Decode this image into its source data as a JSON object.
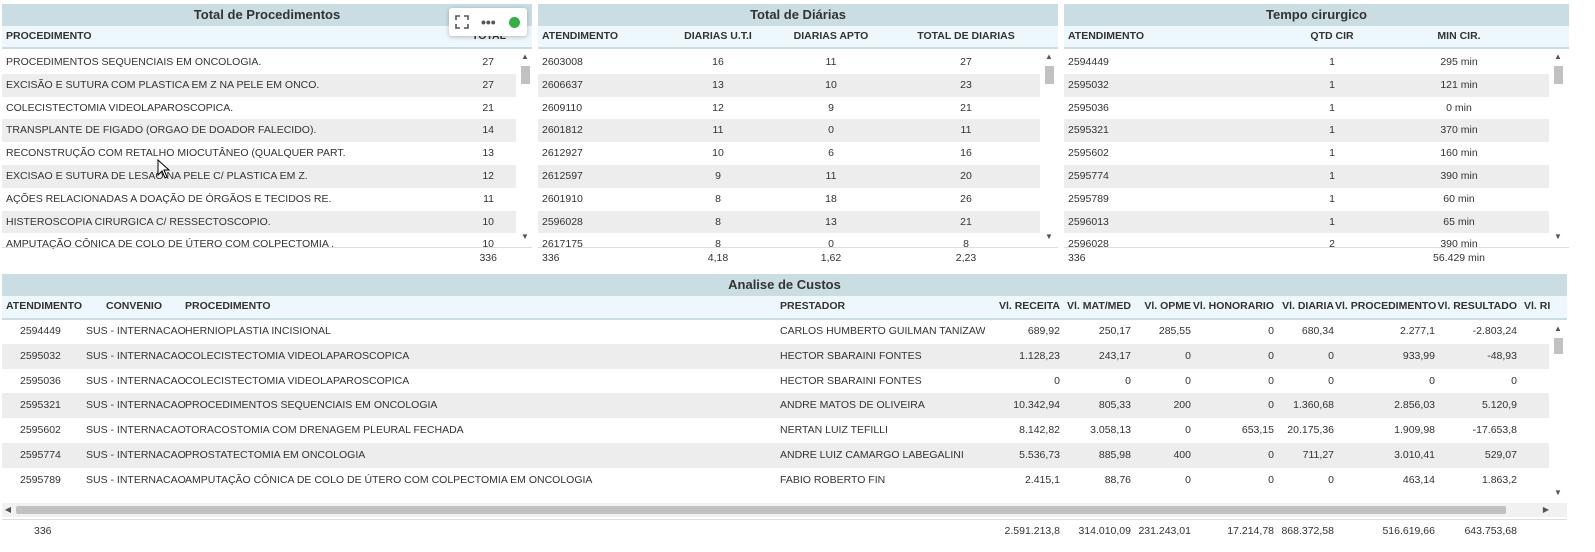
{
  "panels": {
    "procedimentos": {
      "title": "Total de Procedimentos",
      "headers": {
        "procedimento": "PROCEDIMENTO",
        "total": "TOTAL"
      },
      "rows": [
        {
          "procedimento": "PROCEDIMENTOS SEQUENCIAIS EM ONCOLOGIA.",
          "total": "27"
        },
        {
          "procedimento": "EXCISÃO E SUTURA COM PLASTICA EM Z NA PELE EM ONCO.",
          "total": "27"
        },
        {
          "procedimento": "COLECISTECTOMIA VIDEOLAPAROSCOPICA.",
          "total": "21"
        },
        {
          "procedimento": "TRANSPLANTE DE FIGADO (ORGAO DE DOADOR FALECIDO).",
          "total": "14"
        },
        {
          "procedimento": "RECONSTRUÇÃO COM RETALHO MIOCUTÂNEO (QUALQUER PART.",
          "total": "13"
        },
        {
          "procedimento": "EXCISAO E SUTURA DE LESAO NA PELE C/ PLASTICA EM Z.",
          "total": "12"
        },
        {
          "procedimento": "AÇÕES RELACIONADAS A DOAÇÃO DE ÓRGÃOS E TECIDOS RE.",
          "total": "11"
        },
        {
          "procedimento": "HISTEROSCOPIA CIRURGICA C/ RESSECTOSCOPIO.",
          "total": "10"
        },
        {
          "procedimento": "AMPUTAÇÃO CÔNICA DE COLO DE ÚTERO COM COLPECTOMIA .",
          "total": "10"
        }
      ],
      "footer": {
        "total": "336"
      }
    },
    "diarias": {
      "title": "Total de Diárias",
      "headers": {
        "atendimento": "ATENDIMENTO",
        "uti": "DIARIAS U.T.I",
        "apto": "DIARIAS APTO",
        "total": "TOTAL DE DIARIAS"
      },
      "rows": [
        {
          "atendimento": "2603008",
          "uti": "16",
          "apto": "11",
          "total": "27"
        },
        {
          "atendimento": "2606637",
          "uti": "13",
          "apto": "10",
          "total": "23"
        },
        {
          "atendimento": "2609110",
          "uti": "12",
          "apto": "9",
          "total": "21"
        },
        {
          "atendimento": "2601812",
          "uti": "11",
          "apto": "0",
          "total": "11"
        },
        {
          "atendimento": "2612927",
          "uti": "10",
          "apto": "6",
          "total": "16"
        },
        {
          "atendimento": "2612597",
          "uti": "9",
          "apto": "11",
          "total": "20"
        },
        {
          "atendimento": "2601910",
          "uti": "8",
          "apto": "18",
          "total": "26"
        },
        {
          "atendimento": "2596028",
          "uti": "8",
          "apto": "13",
          "total": "21"
        },
        {
          "atendimento": "2617175",
          "uti": "8",
          "apto": "0",
          "total": "8"
        }
      ],
      "footer": {
        "atendimento": "336",
        "uti": "4,18",
        "apto": "1,62",
        "total": "2,23"
      }
    },
    "tempo": {
      "title": "Tempo cirurgico",
      "headers": {
        "atendimento": "ATENDIMENTO",
        "qtd": "QTD CIR",
        "min": "MIN CIR."
      },
      "rows": [
        {
          "atendimento": "2594449",
          "qtd": "1",
          "min": "295 min"
        },
        {
          "atendimento": "2595032",
          "qtd": "1",
          "min": "121 min"
        },
        {
          "atendimento": "2595036",
          "qtd": "1",
          "min": "0 min"
        },
        {
          "atendimento": "2595321",
          "qtd": "1",
          "min": "370 min"
        },
        {
          "atendimento": "2595602",
          "qtd": "1",
          "min": "160 min"
        },
        {
          "atendimento": "2595774",
          "qtd": "1",
          "min": "390 min"
        },
        {
          "atendimento": "2595789",
          "qtd": "1",
          "min": "60 min"
        },
        {
          "atendimento": "2596013",
          "qtd": "1",
          "min": "65 min"
        },
        {
          "atendimento": "2596028",
          "qtd": "2",
          "min": "390 min"
        }
      ],
      "footer": {
        "atendimento": "336",
        "min": "56.429 min"
      }
    },
    "custos": {
      "title": "Analise de Custos",
      "headers": {
        "atendimento": "ATENDIMENTO",
        "convenio": "CONVENIO",
        "procedimento": "PROCEDIMENTO",
        "prestador": "PRESTADOR",
        "receita": "Vl. RECEITA",
        "matmed": "Vl. MAT/MED",
        "opme": "Vl. OPME",
        "honorario": "Vl. HONORARIO",
        "diaria": "Vl. DIARIA",
        "vproc": "Vl. PROCEDIMENTO",
        "resultado": "Vl. RESULTADO",
        "ri": "Vl. RI"
      },
      "rows": [
        {
          "atendimento": "2594449",
          "convenio": "SUS - INTERNACAO",
          "procedimento": "HERNIOPLASTIA INCISIONAL",
          "prestador": "CARLOS HUMBERTO GUILMAN TANIZAWA",
          "receita": "689,92",
          "matmed": "250,17",
          "opme": "285,55",
          "honorario": "0",
          "diaria": "680,34",
          "vproc": "2.277,1",
          "resultado": "-2.803,24"
        },
        {
          "atendimento": "2595032",
          "convenio": "SUS - INTERNACAO",
          "procedimento": "COLECISTECTOMIA VIDEOLAPAROSCOPICA",
          "prestador": "HECTOR SBARAINI FONTES",
          "receita": "1.128,23",
          "matmed": "243,17",
          "opme": "0",
          "honorario": "0",
          "diaria": "0",
          "vproc": "933,99",
          "resultado": "-48,93"
        },
        {
          "atendimento": "2595036",
          "convenio": "SUS - INTERNACAO",
          "procedimento": "COLECISTECTOMIA VIDEOLAPAROSCOPICA",
          "prestador": "HECTOR SBARAINI FONTES",
          "receita": "0",
          "matmed": "0",
          "opme": "0",
          "honorario": "0",
          "diaria": "0",
          "vproc": "0",
          "resultado": "0"
        },
        {
          "atendimento": "2595321",
          "convenio": "SUS - INTERNACAO",
          "procedimento": "PROCEDIMENTOS SEQUENCIAIS EM ONCOLOGIA",
          "prestador": "ANDRE MATOS DE OLIVEIRA",
          "receita": "10.342,94",
          "matmed": "805,33",
          "opme": "200",
          "honorario": "0",
          "diaria": "1.360,68",
          "vproc": "2.856,03",
          "resultado": "5.120,9"
        },
        {
          "atendimento": "2595602",
          "convenio": "SUS - INTERNACAO",
          "procedimento": "TORACOSTOMIA COM DRENAGEM PLEURAL FECHADA",
          "prestador": "NERTAN LUIZ TEFILLI",
          "receita": "8.142,82",
          "matmed": "3.058,13",
          "opme": "0",
          "honorario": "653,15",
          "diaria": "20.175,36",
          "vproc": "1.909,98",
          "resultado": "-17.653,8"
        },
        {
          "atendimento": "2595774",
          "convenio": "SUS - INTERNACAO",
          "procedimento": "PROSTATECTOMIA EM ONCOLOGIA",
          "prestador": "ANDRE LUIZ CAMARGO LABEGALINI",
          "receita": "5.536,73",
          "matmed": "885,98",
          "opme": "400",
          "honorario": "0",
          "diaria": "711,27",
          "vproc": "3.010,41",
          "resultado": "529,07"
        },
        {
          "atendimento": "2595789",
          "convenio": "SUS - INTERNACAO",
          "procedimento": "AMPUTAÇÃO CÔNICA DE COLO DE ÚTERO COM COLPECTOMIA EM ONCOLOGIA",
          "prestador": "FABIO ROBERTO FIN",
          "receita": "2.415,1",
          "matmed": "88,76",
          "opme": "0",
          "honorario": "0",
          "diaria": "0",
          "vproc": "463,14",
          "resultado": "1.863,2"
        }
      ],
      "footer": {
        "atendimento": "336",
        "receita": "2.591.213,8",
        "matmed": "314.010,09",
        "opme": "231.243,01",
        "honorario": "17.214,78",
        "diaria": "868.372,58",
        "vproc": "516.619,66",
        "resultado": "643.753,68"
      }
    }
  },
  "toolbar": {
    "expand_icon": "expand-icon",
    "more_icon": "more-icon",
    "status_color": "#35b043"
  },
  "colors": {
    "header_bar": "#c9dde3",
    "column_header": "#eef7fb",
    "alt_row": "#ededed"
  }
}
